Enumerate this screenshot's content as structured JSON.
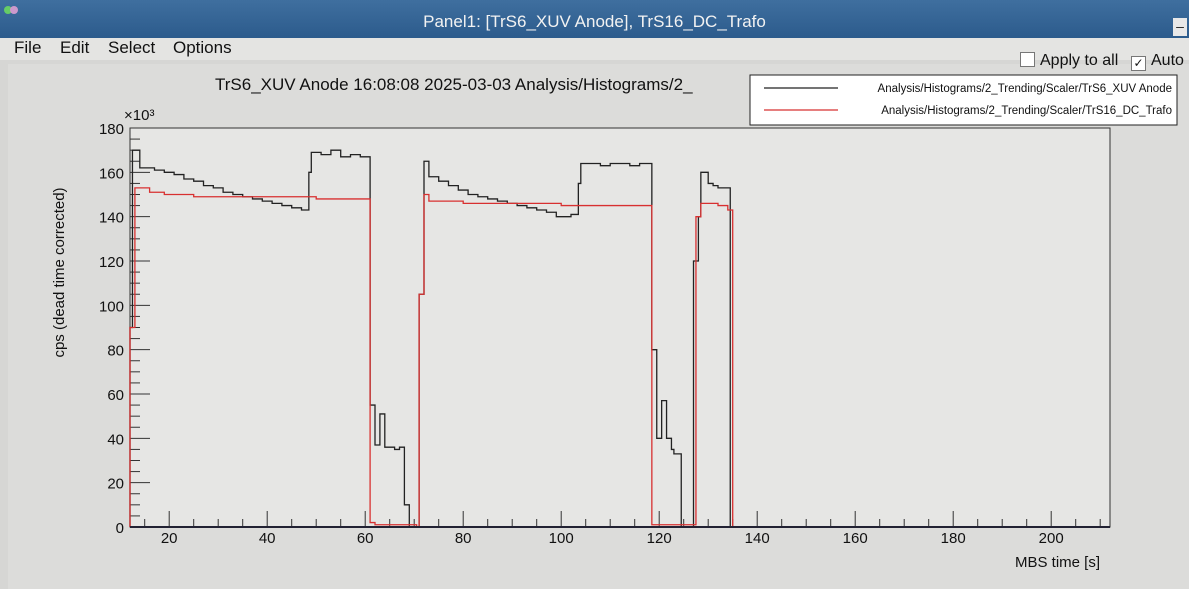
{
  "window": {
    "title": "Panel1: [TrS6_XUV Anode], TrS16_DC_Trafo",
    "minimize_label": "–"
  },
  "menu": {
    "items": [
      "File",
      "Edit",
      "Select",
      "Options"
    ]
  },
  "options": {
    "apply_to_all_label": "Apply to all",
    "apply_to_all_checked": false,
    "auto_label": "Auto",
    "auto_checked": true,
    "check_mark": "✓"
  },
  "chart_data": {
    "type": "line",
    "style": "step-histogram",
    "title": "TrS6_XUV Anode  16:08:08  2025-03-03  Analysis/Histograms/2_",
    "xlabel": "MBS time [s]",
    "ylabel": "cps (dead time corrected)",
    "y_multiplier": "×10³",
    "xlim": [
      12,
      212
    ],
    "ylim": [
      0,
      180
    ],
    "x_ticks": [
      20,
      40,
      60,
      80,
      100,
      120,
      140,
      160,
      180,
      200
    ],
    "y_ticks": [
      0,
      20,
      40,
      60,
      80,
      100,
      120,
      140,
      160,
      180
    ],
    "y_units": "thousands",
    "grid": false,
    "legend_position": "top-right",
    "series": [
      {
        "name": "Analysis/Histograms/2_Trending/Scaler/TrS6_XUV Anode",
        "color": "#222222",
        "steps": [
          [
            12,
            90
          ],
          [
            12.5,
            170
          ],
          [
            14,
            162
          ],
          [
            17,
            161
          ],
          [
            19,
            160
          ],
          [
            21,
            159
          ],
          [
            23,
            157
          ],
          [
            25,
            156
          ],
          [
            27,
            154
          ],
          [
            29,
            153
          ],
          [
            31,
            151
          ],
          [
            33,
            150
          ],
          [
            35,
            149
          ],
          [
            37,
            148
          ],
          [
            39,
            147
          ],
          [
            41,
            146
          ],
          [
            43,
            145
          ],
          [
            45,
            144
          ],
          [
            47,
            143
          ],
          [
            48.5,
            160
          ],
          [
            49,
            169
          ],
          [
            51,
            168
          ],
          [
            53,
            170
          ],
          [
            55,
            167
          ],
          [
            57,
            168
          ],
          [
            59,
            167
          ],
          [
            61,
            55
          ],
          [
            62,
            37
          ],
          [
            63,
            51
          ],
          [
            64,
            36
          ],
          [
            66,
            35
          ],
          [
            67,
            36
          ],
          [
            68,
            10
          ],
          [
            69,
            0
          ],
          [
            71,
            105
          ],
          [
            72,
            165
          ],
          [
            73,
            158
          ],
          [
            75,
            156
          ],
          [
            77,
            154
          ],
          [
            79,
            152
          ],
          [
            81,
            150
          ],
          [
            83,
            149
          ],
          [
            85,
            148
          ],
          [
            87,
            147
          ],
          [
            89,
            146
          ],
          [
            91,
            145
          ],
          [
            93,
            144
          ],
          [
            95,
            143
          ],
          [
            97,
            142
          ],
          [
            99,
            140
          ],
          [
            102,
            141
          ],
          [
            103.5,
            155
          ],
          [
            104,
            164
          ],
          [
            108,
            163
          ],
          [
            110,
            164
          ],
          [
            114,
            163
          ],
          [
            116,
            164
          ],
          [
            118.5,
            80
          ],
          [
            119.5,
            40
          ],
          [
            120.5,
            57
          ],
          [
            121.5,
            40
          ],
          [
            122.5,
            35
          ],
          [
            123,
            33
          ],
          [
            124.5,
            0
          ],
          [
            127,
            120
          ],
          [
            128,
            140
          ],
          [
            128.5,
            160
          ],
          [
            130,
            155
          ],
          [
            131,
            154
          ],
          [
            132,
            153
          ],
          [
            134.5,
            0
          ]
        ],
        "end": 212
      },
      {
        "name": "Analysis/Histograms/2_Trending/Scaler/TrS16_DC_Trafo",
        "color": "#d83030",
        "steps": [
          [
            12,
            90
          ],
          [
            13,
            153
          ],
          [
            16,
            151
          ],
          [
            19,
            150
          ],
          [
            25,
            149
          ],
          [
            40,
            149
          ],
          [
            50,
            148
          ],
          [
            61,
            2
          ],
          [
            62,
            1
          ],
          [
            70.5,
            0
          ],
          [
            71,
            105
          ],
          [
            72,
            150
          ],
          [
            73,
            147
          ],
          [
            80,
            146
          ],
          [
            90,
            146
          ],
          [
            100,
            145
          ],
          [
            110,
            145
          ],
          [
            118.5,
            1
          ],
          [
            127.5,
            140
          ],
          [
            128.5,
            146
          ],
          [
            132,
            145
          ],
          [
            134,
            143
          ],
          [
            135,
            0
          ]
        ],
        "end": 212
      }
    ]
  }
}
